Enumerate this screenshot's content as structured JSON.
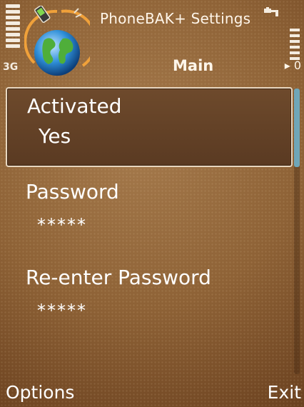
{
  "status_bar": {
    "network": "3G",
    "app_title": "PhoneBAK+ Settings",
    "signal_icon": "signal-strength-icon",
    "battery_icon": "battery-level-icon",
    "charge_icon": "charging-icon"
  },
  "header": {
    "tab_title": "Main",
    "tab_arrow": "▸ 0"
  },
  "settings": [
    {
      "label": "Activated",
      "value": "Yes",
      "selected": true
    },
    {
      "label": "Password",
      "value": "*****",
      "selected": false
    },
    {
      "label": "Re-enter Password",
      "value": "*****",
      "selected": false
    }
  ],
  "softkeys": {
    "left": "Options",
    "right": "Exit"
  },
  "colors": {
    "background": "#8e6236",
    "selection_border": "#e8d6bf",
    "scroll_thumb": "#6fa6b8",
    "text": "#ffffff"
  }
}
